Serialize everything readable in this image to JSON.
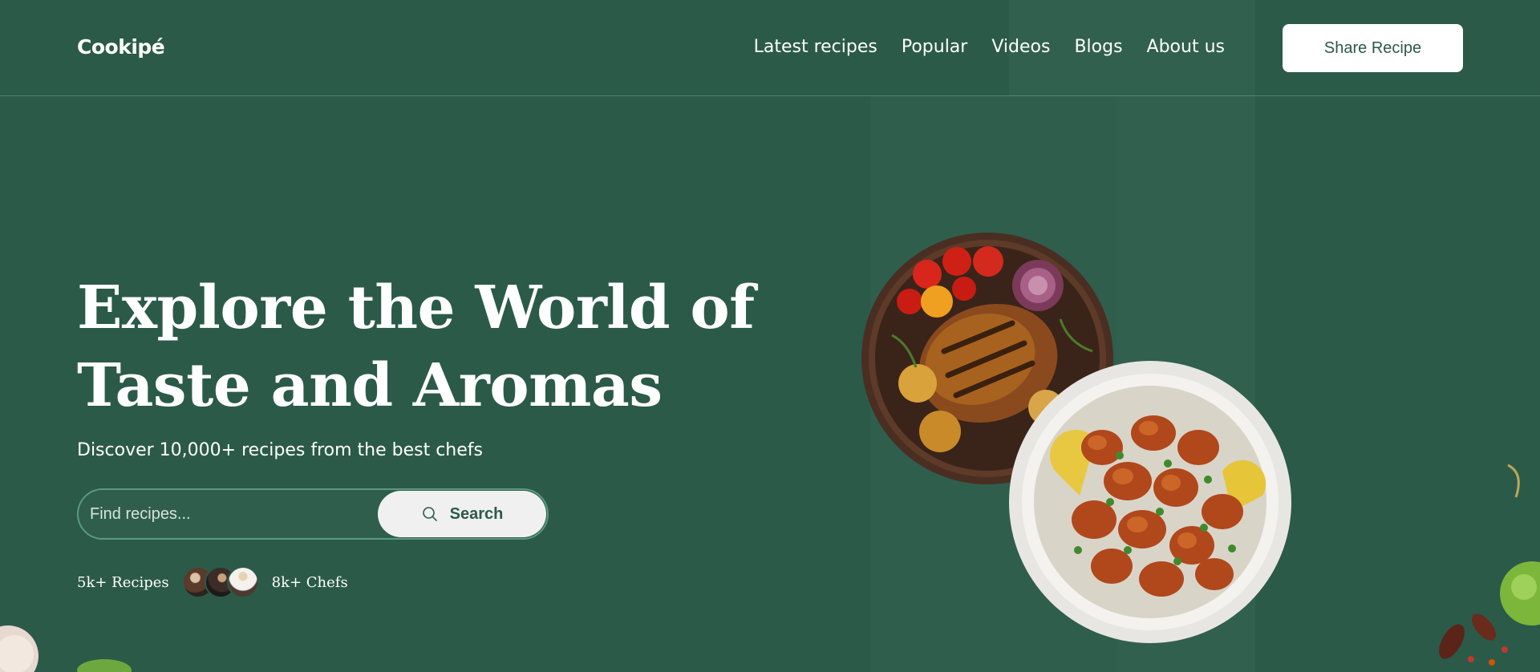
{
  "brand": {
    "logo": "Cookipé"
  },
  "nav": {
    "links": [
      "Latest recipes",
      "Popular",
      "Videos",
      "Blogs",
      "About us"
    ],
    "cta": "Share Recipe"
  },
  "hero": {
    "title_line1": "Explore the World of",
    "title_line2": "Taste and Aromas",
    "subtitle": "Discover 10,000+ recipes from the best chefs"
  },
  "search": {
    "placeholder": "Find recipes...",
    "button": "Search"
  },
  "stats": {
    "recipes": "5k+ Recipes",
    "chefs": "8k+ Chefs"
  },
  "icons": {
    "search": "search-icon",
    "avatars": [
      "chef-avatar",
      "chef-avatar",
      "chef-avatar"
    ]
  },
  "colors": {
    "background": "#2b5a49",
    "accent": "#ffffff",
    "button_text": "#2b5a49"
  }
}
